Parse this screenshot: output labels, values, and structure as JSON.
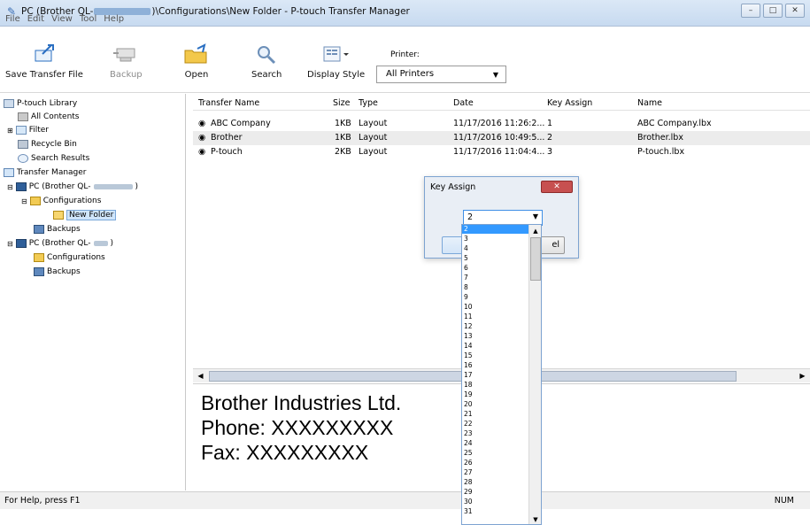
{
  "title": {
    "prefix": "PC (Brother QL-",
    "suffix": ")\\Configurations\\New Folder - P-touch Transfer Manager"
  },
  "menu": [
    "File",
    "Edit",
    "View",
    "Tool",
    "Help"
  ],
  "toolbar": {
    "save_transfer_file": "Save Transfer File",
    "backup": "Backup",
    "open": "Open",
    "search": "Search",
    "display_style": "Display Style",
    "printer_label": "Printer:",
    "printer_value": "All Printers"
  },
  "tree": {
    "library": "P-touch Library",
    "all_contents": "All Contents",
    "filter": "Filter",
    "recycle_bin": "Recycle Bin",
    "search_results": "Search Results",
    "transfer_manager": "Transfer Manager",
    "pc1": "PC (Brother QL-",
    "pc1_configurations": "Configurations",
    "new_folder": "New Folder",
    "pc1_backups": "Backups",
    "pc2": "PC (Brother QL-",
    "pc2_configurations": "Configurations",
    "pc2_backups": "Backups"
  },
  "table": {
    "headers": [
      "Transfer Name",
      "Size",
      "Type",
      "Date",
      "Key Assign",
      "Name"
    ],
    "rows": [
      [
        "ABC Company",
        "1KB",
        "Layout",
        "11/17/2016 11:26:2...",
        "1",
        "ABC Company.lbx"
      ],
      [
        "Brother",
        "1KB",
        "Layout",
        "11/17/2016 10:49:5...",
        "2",
        "Brother.lbx"
      ],
      [
        "P-touch",
        "2KB",
        "Layout",
        "11/17/2016 11:04:4...",
        "3",
        "P-touch.lbx"
      ]
    ]
  },
  "preview": {
    "line1": "Brother Industries Ltd.",
    "line2": "Phone: XXXXXXXXX",
    "line3": "Fax: XXXXXXXXX"
  },
  "status": {
    "help": "For Help, press F1",
    "num": "NUM"
  },
  "dialog": {
    "title": "Key Assign",
    "selected": "2",
    "cancel_partial": "el"
  },
  "dropdown_options": [
    "2",
    "3",
    "4",
    "5",
    "6",
    "7",
    "8",
    "9",
    "10",
    "11",
    "12",
    "13",
    "14",
    "15",
    "16",
    "17",
    "18",
    "19",
    "20",
    "21",
    "22",
    "23",
    "24",
    "25",
    "26",
    "27",
    "28",
    "29",
    "30",
    "31"
  ]
}
